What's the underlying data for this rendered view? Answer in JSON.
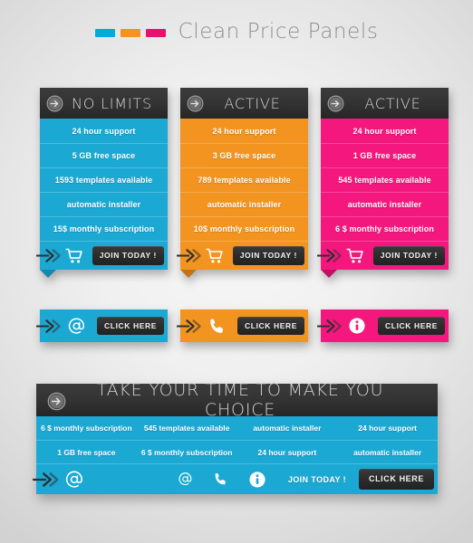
{
  "page": {
    "title": "Clean Price Panels",
    "title_dashes": [
      "#00aadc",
      "#f2941f",
      "#e8126e"
    ],
    "background_color": "#efefef"
  },
  "colors": {
    "cyan": "#1ba9d4",
    "orange": "#f2941f",
    "pink": "#f4177d",
    "dark": "#2c2c2c",
    "title_text": "#8e8e8e"
  },
  "panels": [
    {
      "header_title": "NO LIMITS",
      "header_icon": "circle-arrow-right-icon",
      "color": "#1ba9d4",
      "tail_color": "#1688ab",
      "rows": [
        "24 hour support",
        "5 GB free space",
        "1593 templates available",
        "automatic installer",
        "15$ monthly subscription"
      ],
      "foot": {
        "arrow_icon": "double-chevron-right-icon",
        "item_icon": "shopping-cart-icon",
        "button_label": "JOIN TODAY !"
      }
    },
    {
      "header_title": "ACTIVE",
      "header_icon": "circle-arrow-right-icon",
      "color": "#f2941f",
      "tail_color": "#c0741a",
      "rows": [
        "24 hour support",
        "3 GB free space",
        "789 templates available",
        "automatic installer",
        "10$ monthly subscription"
      ],
      "foot": {
        "arrow_icon": "double-chevron-right-icon",
        "item_icon": "shopping-cart-icon",
        "button_label": "JOIN TODAY !"
      }
    },
    {
      "header_title": "ACTIVE",
      "header_icon": "circle-arrow-right-icon",
      "color": "#f4177d",
      "tail_color": "#c01262",
      "rows": [
        "24 hour support",
        "1 GB free space",
        "545 templates available",
        "automatic installer",
        "6 $ monthly subscription"
      ],
      "foot": {
        "arrow_icon": "double-chevron-right-icon",
        "item_icon": "shopping-cart-icon",
        "button_label": "JOIN TODAY !"
      }
    }
  ],
  "cta_bars": [
    {
      "color": "#1ba9d4",
      "arrow_icon": "double-chevron-right-icon",
      "icon": "at-sign-icon",
      "button_label": "CLICK HERE"
    },
    {
      "color": "#f2941f",
      "arrow_icon": "double-chevron-right-icon",
      "icon": "phone-icon",
      "button_label": "CLICK HERE"
    },
    {
      "color": "#f4177d",
      "arrow_icon": "double-chevron-right-icon",
      "icon": "info-circle-icon",
      "button_label": "CLICK HERE"
    }
  ],
  "wide_panel": {
    "header_title": "TAKE YOUR TIME TO MAKE YOU CHOICE",
    "header_icon": "circle-arrow-right-icon",
    "color": "#1ba9d4",
    "rows": [
      [
        "6 $ monthly subscription",
        "545 templates available",
        "automatic installer",
        "24 hour support"
      ],
      [
        "1 GB free space",
        "6 $ monthly subscription",
        "24 hour support",
        "automatic installer"
      ]
    ],
    "foot": {
      "arrow_icon": "double-chevron-right-icon",
      "main_icon": "at-sign-icon",
      "icons": [
        "at-sign-icon",
        "phone-icon",
        "info-circle-icon"
      ],
      "join_label": "JOIN TODAY !",
      "button_label": "CLICK HERE"
    }
  }
}
